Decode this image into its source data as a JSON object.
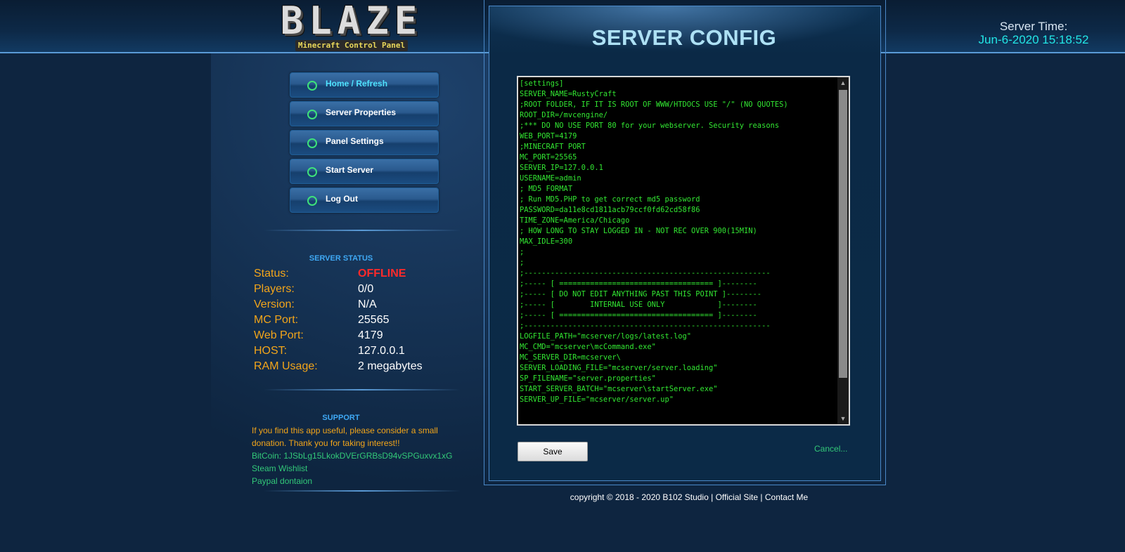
{
  "header": {
    "logo_text": "BLAZE",
    "logo_subtitle": "Minecraft Control Panel",
    "server_time_label": "Server Time:",
    "server_time_value": "Jun-6-2020 15:18:52"
  },
  "nav": {
    "items": [
      {
        "label": "Home / Refresh",
        "active": true
      },
      {
        "label": "Server Properties",
        "active": false
      },
      {
        "label": "Panel Settings",
        "active": false
      },
      {
        "label": "Start Server",
        "active": false
      },
      {
        "label": "Log Out",
        "active": false
      }
    ]
  },
  "server_status": {
    "title": "SERVER STATUS",
    "rows": [
      {
        "key": "Status:",
        "value": "OFFLINE"
      },
      {
        "key": "Players:",
        "value": "0/0"
      },
      {
        "key": "Version:",
        "value": "N/A"
      },
      {
        "key": "MC Port:",
        "value": "25565"
      },
      {
        "key": "Web Port:",
        "value": "4179"
      },
      {
        "key": "HOST:",
        "value": "127.0.0.1"
      },
      {
        "key": "RAM Usage:",
        "value": "2 megabytes"
      }
    ]
  },
  "support": {
    "title": "SUPPORT",
    "text": "If you find this app useful, please consider a small donation. Thank you for taking interest!!",
    "bitcoin": "BitCoin: 1JSbLg15LkokDVErGRBsD94vSPGuxvx1xG",
    "steam": "Steam Wishlist",
    "paypal": "Paypal dontaion"
  },
  "config": {
    "title": "SERVER CONFIG",
    "content": "[settings]\nSERVER_NAME=RustyCraft\n;ROOT FOLDER, IF IT IS ROOT OF WWW/HTDOCS USE \"/\" (NO QUOTES)\nROOT_DIR=/mvcengine/\n;*** DO NO USE PORT 80 for your webserver. Security reasons\nWEB_PORT=4179\n;MINECRAFT PORT\nMC_PORT=25565\nSERVER_IP=127.0.0.1\nUSERNAME=admin\n; MD5 FORMAT\n; Run MD5.PHP to get correct md5 password\nPASSWORD=da11e8cd1811acb79ccf0fd62cd58f86\nTIME_ZONE=America/Chicago\n; HOW LONG TO STAY LOGGED IN - NOT REC OVER 900(15MIN)\nMAX_IDLE=300\n;\n;\n;--------------------------------------------------------\n;----- [ =================================== ]--------\n;----- [ DO NOT EDIT ANYTHING PAST THIS POINT ]--------\n;----- [        INTERNAL USE ONLY            ]--------\n;----- [ =================================== ]--------\n;--------------------------------------------------------\nLOGFILE_PATH=\"mcserver/logs/latest.log\"\nMC_CMD=\"mcserver\\mcCommand.exe\"\nMC_SERVER_DIR=mcserver\\\nSERVER_LOADING_FILE=\"mcserver/server.loading\"\nSP_FILENAME=\"server.properties\"\nSTART_SERVER_BATCH=\"mcserver\\startServer.exe\"\nSERVER_UP_FILE=\"mcserver/server.up\"",
    "save_label": "Save",
    "cancel_label": "Cancel..."
  },
  "footer": {
    "copyright": "copyright © 2018 - 2020 B102 Studio",
    "official_site": "Official Site",
    "contact": "Contact Me",
    "separator": "|"
  }
}
